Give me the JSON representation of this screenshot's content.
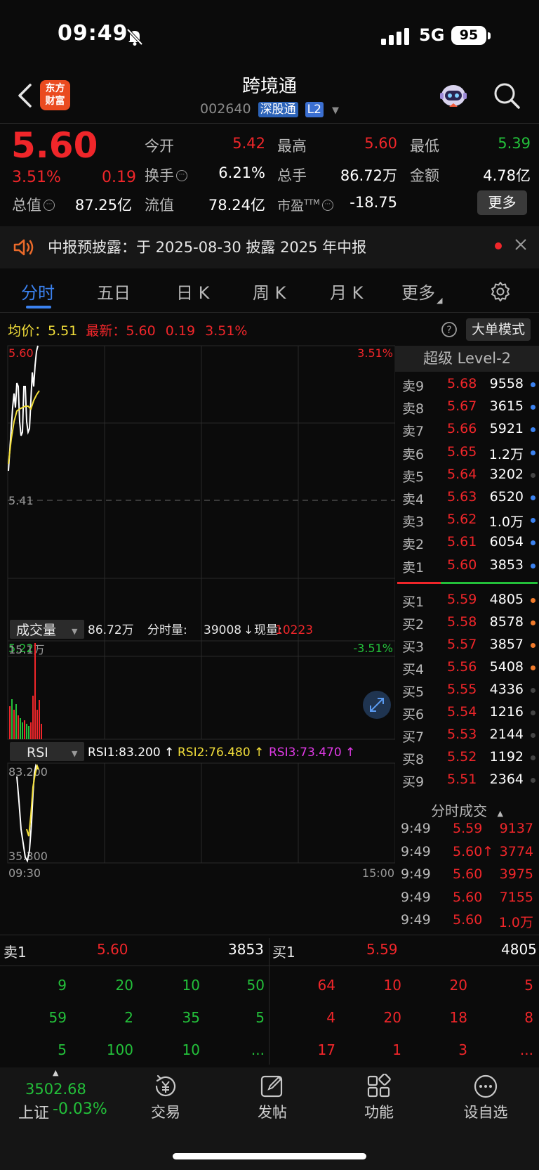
{
  "status": {
    "time": "09:49",
    "network": "5G",
    "battery": "95"
  },
  "header": {
    "logo_line1": "东方",
    "logo_line2": "财富",
    "name": "跨境通",
    "code": "002640",
    "tag_connect": "深股通",
    "tag_level": "L2"
  },
  "quote": {
    "price": "5.60",
    "pct": "3.51%",
    "change": "0.19",
    "open_label": "今开",
    "open": "5.42",
    "high_label": "最高",
    "high": "5.60",
    "low_label": "最低",
    "low": "5.39",
    "turnover_label": "换手",
    "turnover": "6.21%",
    "volume_label": "总手",
    "volume": "86.72万",
    "amount_label": "金额",
    "amount": "4.78亿",
    "mktcap_label": "总值",
    "mktcap": "87.25亿",
    "float_label": "流值",
    "float": "78.24亿",
    "pe_label": "市盈",
    "pe_sup": "TTM",
    "pe": "-18.75",
    "more_label": "更多"
  },
  "notice": {
    "text": "中报预披露：于 2025-08-30 披露 2025 年中报"
  },
  "tabs": [
    "分时",
    "五日",
    "日 K",
    "周 K",
    "月 K",
    "更多"
  ],
  "avg_row": {
    "avg_label": "均价：",
    "avg": "5.51",
    "latest_label": "最新：",
    "latest": "5.60",
    "chg": "0.19",
    "pct": "3.51%",
    "big_order_label": "大单模式"
  },
  "chart": {
    "price_top": "5.60",
    "price_mid": "5.41",
    "price_bottom": "5.22",
    "pct_top": "3.51%",
    "pct_bottom": "-3.51%",
    "vol_selector": "成交量",
    "vol_total": "86.72万",
    "vol_period_label": "分时量:",
    "vol_period": "39008",
    "vol_now_label": "现量:",
    "vol_now": "10223",
    "vol_max": "15.1万",
    "rsi_selector": "RSI",
    "rsi1": "RSI1:83.200 ↑",
    "rsi2": "RSI2:76.480 ↑",
    "rsi3": "RSI3:73.470 ↑",
    "rsi_top": "83.200",
    "rsi_bottom": "35.300",
    "time_start": "09:30",
    "time_end": "15:00"
  },
  "level2": {
    "title": "超级 Level-2",
    "asks": [
      {
        "label": "卖9",
        "price": "5.68",
        "vol": "9558",
        "dot": "#3b82f0"
      },
      {
        "label": "卖8",
        "price": "5.67",
        "vol": "3615",
        "dot": "#3b82f0"
      },
      {
        "label": "卖7",
        "price": "5.66",
        "vol": "5921",
        "dot": "#3b82f0"
      },
      {
        "label": "卖6",
        "price": "5.65",
        "vol": "1.2万",
        "dot": "#3b82f0"
      },
      {
        "label": "卖5",
        "price": "5.64",
        "vol": "3202",
        "dot": "#444444"
      },
      {
        "label": "卖4",
        "price": "5.63",
        "vol": "6520",
        "dot": "#3b82f0"
      },
      {
        "label": "卖3",
        "price": "5.62",
        "vol": "1.0万",
        "dot": "#3b82f0"
      },
      {
        "label": "卖2",
        "price": "5.61",
        "vol": "6054",
        "dot": "#3b82f0"
      },
      {
        "label": "卖1",
        "price": "5.60",
        "vol": "3853",
        "dot": "#3b82f0"
      }
    ],
    "bids": [
      {
        "label": "买1",
        "price": "5.59",
        "vol": "4805",
        "dot": "#f07a2a"
      },
      {
        "label": "买2",
        "price": "5.58",
        "vol": "8578",
        "dot": "#f07a2a"
      },
      {
        "label": "买3",
        "price": "5.57",
        "vol": "3857",
        "dot": "#f07a2a"
      },
      {
        "label": "买4",
        "price": "5.56",
        "vol": "5408",
        "dot": "#f07a2a"
      },
      {
        "label": "买5",
        "price": "5.55",
        "vol": "4336",
        "dot": "#444444"
      },
      {
        "label": "买6",
        "price": "5.54",
        "vol": "1216",
        "dot": "#444444"
      },
      {
        "label": "买7",
        "price": "5.53",
        "vol": "2144",
        "dot": "#444444"
      },
      {
        "label": "买8",
        "price": "5.52",
        "vol": "1192",
        "dot": "#444444"
      },
      {
        "label": "买9",
        "price": "5.51",
        "vol": "2364",
        "dot": "#444444"
      }
    ],
    "trades_title": "分时成交",
    "trades": [
      {
        "time": "9:49",
        "price": "5.59",
        "vol": "9137"
      },
      {
        "time": "9:49",
        "price": "5.60↑",
        "vol": "3774"
      },
      {
        "time": "9:49",
        "price": "5.60",
        "vol": "3975"
      },
      {
        "time": "9:49",
        "price": "5.60",
        "vol": "7155"
      },
      {
        "time": "9:49",
        "price": "5.60",
        "vol": "1.0万"
      }
    ]
  },
  "book": {
    "ask_label": "卖1",
    "ask_price": "5.60",
    "ask_vol": "3853",
    "bid_label": "买1",
    "bid_price": "5.59",
    "bid_vol": "4805",
    "ask_queue": [
      [
        "9",
        "20",
        "10",
        "50"
      ],
      [
        "59",
        "2",
        "35",
        "5"
      ],
      [
        "5",
        "100",
        "10",
        "..."
      ]
    ],
    "bid_queue": [
      [
        "64",
        "10",
        "20",
        "5"
      ],
      [
        "4",
        "20",
        "18",
        "8"
      ],
      [
        "17",
        "1",
        "3",
        "..."
      ]
    ]
  },
  "nav": {
    "index_value": "3502.68",
    "index_name": "上证",
    "index_change": "-0.03%",
    "trade": "交易",
    "post": "发帖",
    "functions": "功能",
    "watchlist": "设自选"
  }
}
